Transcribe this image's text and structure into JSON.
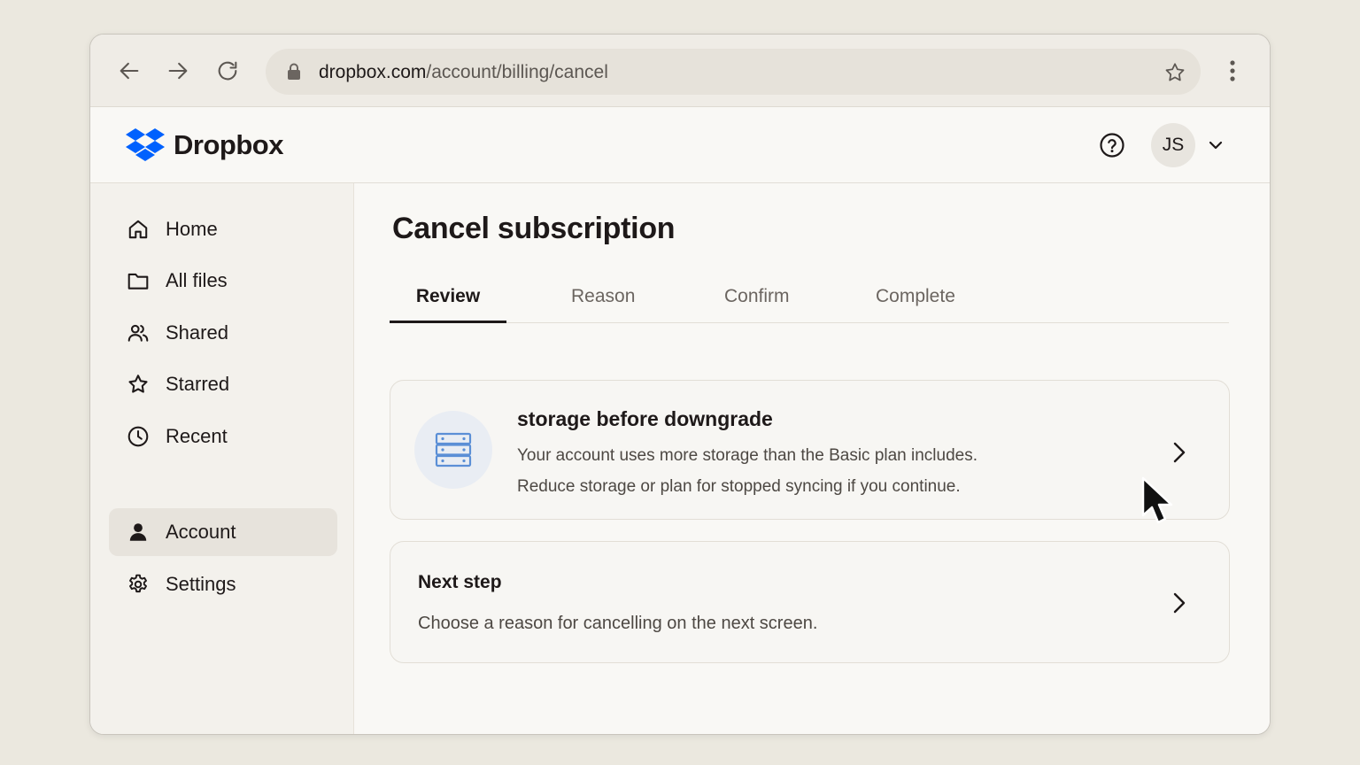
{
  "browser": {
    "url_host": "dropbox.com",
    "url_path": "/account/billing/cancel"
  },
  "header": {
    "brand": "Dropbox",
    "avatar_initials": "JS",
    "brand_color": "#0061fe"
  },
  "sidebar": {
    "items": [
      {
        "label": "Home",
        "icon": "home-icon"
      },
      {
        "label": "All files",
        "icon": "folder-icon"
      },
      {
        "label": "Shared",
        "icon": "people-icon"
      },
      {
        "label": "Starred",
        "icon": "star-icon"
      },
      {
        "label": "Recent",
        "icon": "clock-icon"
      },
      {
        "label": "Account",
        "icon": "person-icon",
        "active": true
      },
      {
        "label": "Settings",
        "icon": "gear-icon"
      }
    ]
  },
  "main": {
    "title": "Cancel subscription",
    "tabs": [
      {
        "label": "Review",
        "active": true
      },
      {
        "label": "Reason"
      },
      {
        "label": "Confirm"
      },
      {
        "label": "Complete"
      }
    ],
    "cards": [
      {
        "title": "storage before downgrade",
        "line1": "Your account uses more storage than the Basic plan includes.",
        "line2": "Reduce storage or plan for stopped syncing if you continue.",
        "icon": "storage-icon"
      },
      {
        "title": "Next step",
        "line1": "Choose a reason for cancelling on the next screen."
      }
    ]
  }
}
